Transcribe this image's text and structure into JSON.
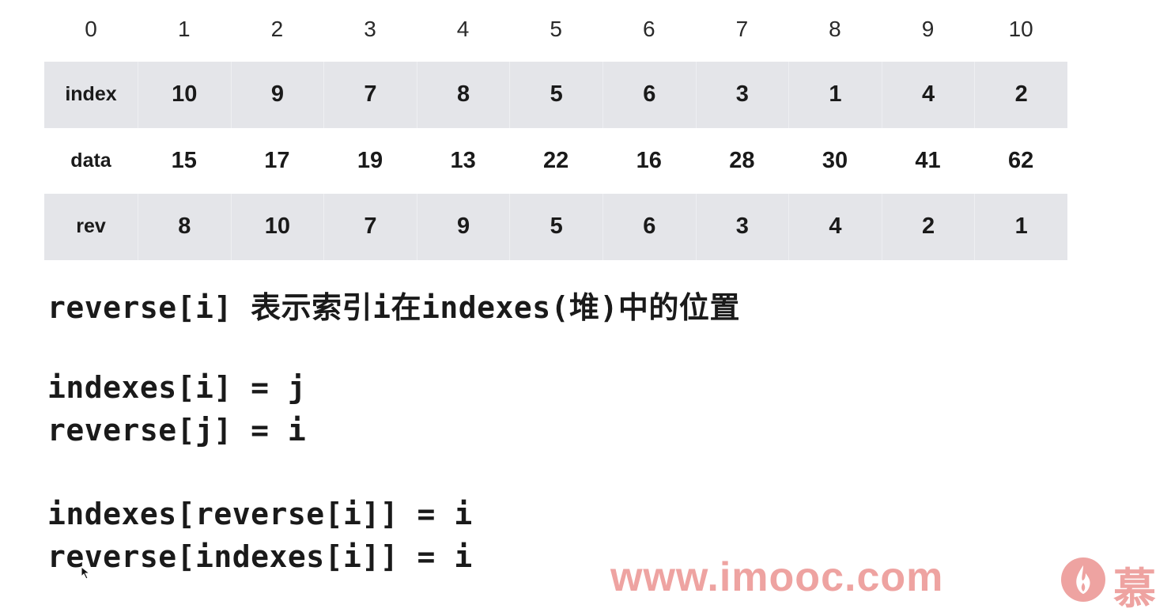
{
  "header": [
    "0",
    "1",
    "2",
    "3",
    "4",
    "5",
    "6",
    "7",
    "8",
    "9",
    "10"
  ],
  "table": {
    "rows": [
      {
        "label": "index",
        "values": [
          "10",
          "9",
          "7",
          "8",
          "5",
          "6",
          "3",
          "1",
          "4",
          "2"
        ]
      },
      {
        "label": "data",
        "values": [
          "15",
          "17",
          "19",
          "13",
          "22",
          "16",
          "28",
          "30",
          "41",
          "62"
        ]
      },
      {
        "label": "rev",
        "values": [
          "8",
          "10",
          "7",
          "9",
          "5",
          "6",
          "3",
          "4",
          "2",
          "1"
        ]
      }
    ]
  },
  "notes": {
    "line1": "reverse[i] 表示索引i在indexes(堆)中的位置",
    "line2": "indexes[i] = j",
    "line3": "reverse[j] = i",
    "line4": "indexes[reverse[i]] = i",
    "line5": "reverse[indexes[i]] = i"
  },
  "watermark": {
    "text": "www.imooc.com",
    "char": "慕",
    "color": "#eea3a1"
  },
  "icons": {
    "watermark_logo": "imooc-flame-logo-icon",
    "cursor": "mouse-cursor-icon"
  }
}
